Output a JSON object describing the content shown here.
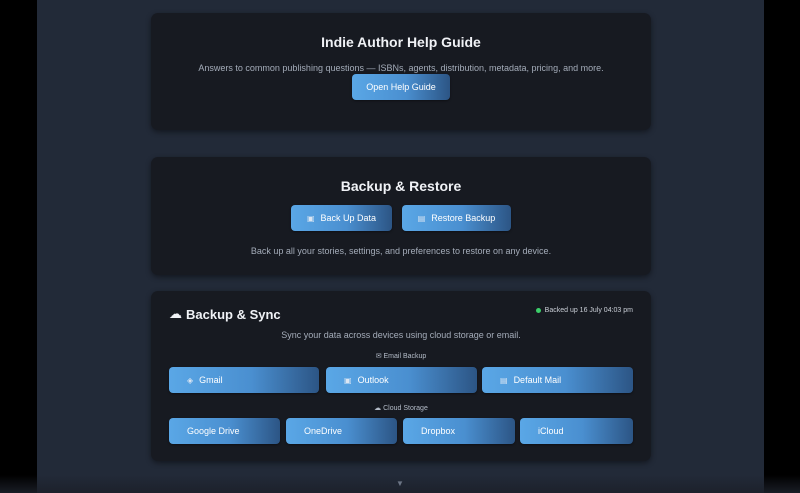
{
  "help_card": {
    "title": "Indie Author Help Guide",
    "description": "Answers to common publishing questions — ISBNs, agents, distribution, metadata, pricing, and more.",
    "button_label": "Open Help Guide"
  },
  "backup_card": {
    "title": "Backup & Restore",
    "backup_button": "Back Up Data",
    "restore_button": "Restore Backup",
    "description": "Back up all your stories, settings, and preferences to restore on any device."
  },
  "sync_card": {
    "title": "Backup & Sync",
    "status": "Backed up 16 July 04:03 pm",
    "status_color": "#3ccf6a",
    "description": "Sync your data across devices using cloud storage or email.",
    "email_section_label": "Email Backup",
    "email_buttons": [
      {
        "label": "Gmail",
        "icon": "gmail-icon"
      },
      {
        "label": "Outlook",
        "icon": "outlook-icon"
      },
      {
        "label": "Default Mail",
        "icon": "mail-icon"
      }
    ],
    "cloud_section_label": "Cloud Storage",
    "cloud_buttons": [
      {
        "label": "Google Drive"
      },
      {
        "label": "OneDrive"
      },
      {
        "label": "Dropbox"
      },
      {
        "label": "iCloud"
      }
    ]
  },
  "colors": {
    "accent": "#4a8fd0",
    "card_bg": "#171a21",
    "page_bg": "#222a38"
  }
}
